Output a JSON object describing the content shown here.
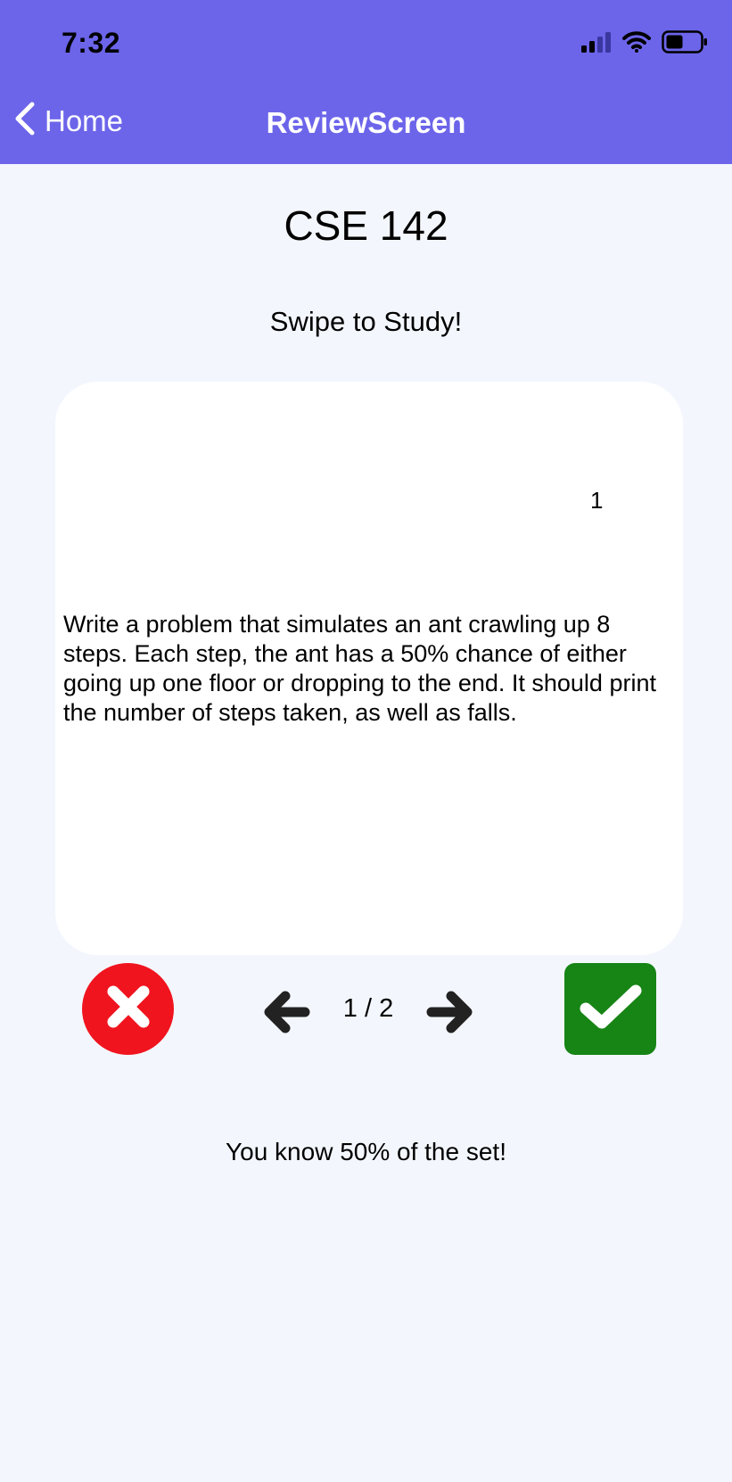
{
  "status_bar": {
    "time": "7:32",
    "signal_icon": "cellular-signal-icon",
    "wifi_icon": "wifi-icon",
    "battery_icon": "battery-icon"
  },
  "nav": {
    "back_label": "Home",
    "back_icon": "chevron-left-icon",
    "title": "ReviewScreen"
  },
  "content": {
    "course_title": "CSE 142",
    "subtitle": "Swipe to Study!"
  },
  "card": {
    "number": "1",
    "text": "Write a problem that simulates an ant crawling up 8 steps. Each step, the ant has a 50% chance of either going up one floor or dropping to the end. It should print the number of steps taken, as well as falls."
  },
  "controls": {
    "wrong_icon": "close-icon",
    "prev_icon": "arrow-left-icon",
    "pager": "1 / 2",
    "next_icon": "arrow-right-icon",
    "right_icon": "checkmark-icon"
  },
  "footer": {
    "progress_text": "You know 50% of the set!"
  },
  "colors": {
    "header": "#6c65ea",
    "background": "#f3f7fd",
    "wrong": "#f0141f",
    "right": "#178416"
  }
}
